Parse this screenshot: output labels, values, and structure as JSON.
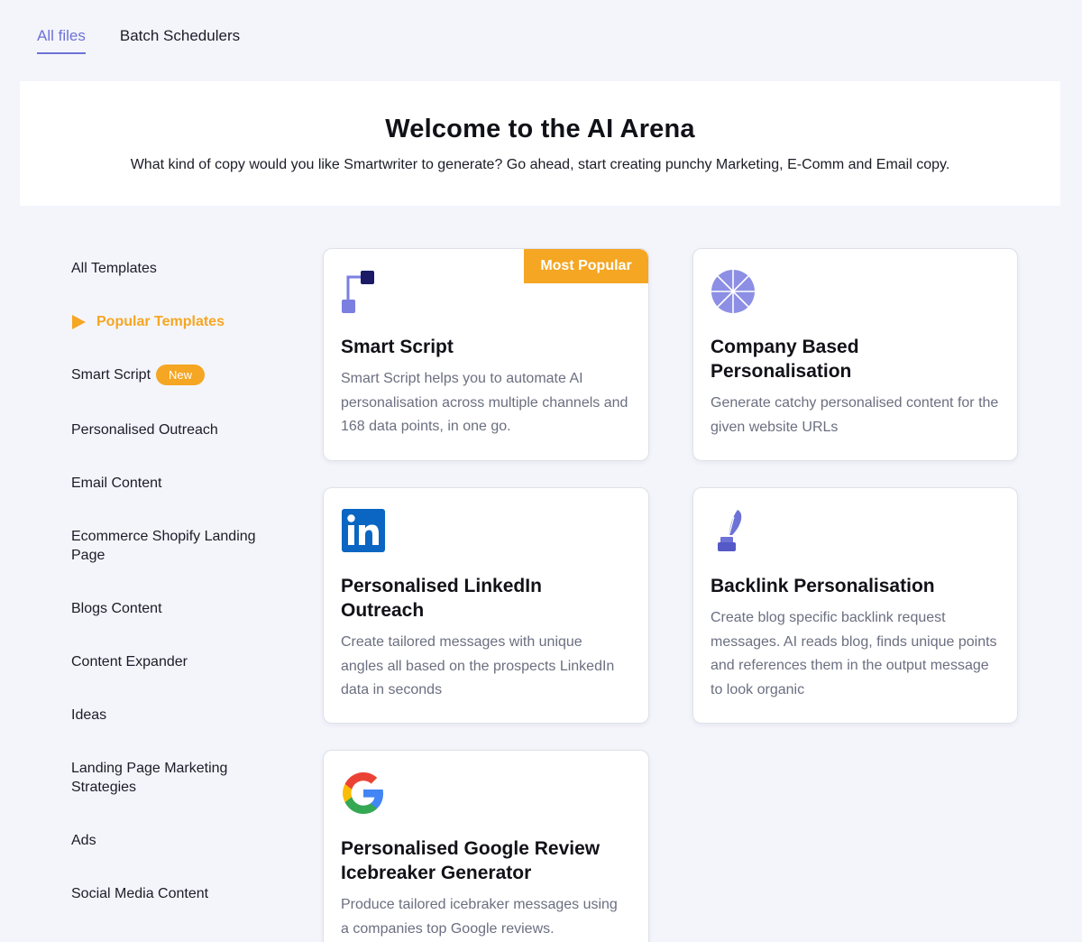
{
  "tabs": [
    {
      "label": "All files",
      "active": true
    },
    {
      "label": "Batch Schedulers",
      "active": false
    }
  ],
  "banner": {
    "title": "Welcome to the AI Arena",
    "subtitle": "What kind of copy would you like Smartwriter to generate? Go ahead, start creating punchy Marketing, E-Comm and Email copy."
  },
  "sidebar": {
    "items": [
      {
        "label": "All Templates"
      },
      {
        "label": "Popular Templates",
        "active": true
      },
      {
        "label": "Smart Script",
        "badge": "New"
      },
      {
        "label": "Personalised Outreach"
      },
      {
        "label": "Email Content"
      },
      {
        "label": "Ecommerce Shopify Landing Page"
      },
      {
        "label": "Blogs Content"
      },
      {
        "label": "Content Expander"
      },
      {
        "label": "Ideas"
      },
      {
        "label": "Landing Page Marketing Strategies"
      },
      {
        "label": "Ads"
      },
      {
        "label": "Social Media Content"
      }
    ]
  },
  "cards": [
    {
      "title": "Smart Script",
      "ribbon": "Most Popular",
      "icon": "smart-script-icon",
      "description": "Smart Script helps you to automate AI personalisation across multiple channels and 168 data points, in one go."
    },
    {
      "title": "Company Based Personalisation",
      "icon": "company-wheel-icon",
      "description": "Generate catchy personalised content for the given website URLs"
    },
    {
      "title": "Personalised LinkedIn Outreach",
      "icon": "linkedin-icon",
      "description": "Create tailored messages with unique angles all based on the prospects LinkedIn data in seconds"
    },
    {
      "title": "Backlink Personalisation",
      "icon": "quill-ink-icon",
      "description": "Create blog specific backlink request messages. AI reads blog, finds unique points and references them in the output message to look organic"
    },
    {
      "title": "Personalised Google Review Icebreaker Generator",
      "icon": "google-icon",
      "description": "Produce tailored icebraker messages using a companies top Google reviews."
    }
  ],
  "colors": {
    "accent": "#6d72d6",
    "highlight": "#f5a623",
    "background": "#f4f5fb"
  }
}
